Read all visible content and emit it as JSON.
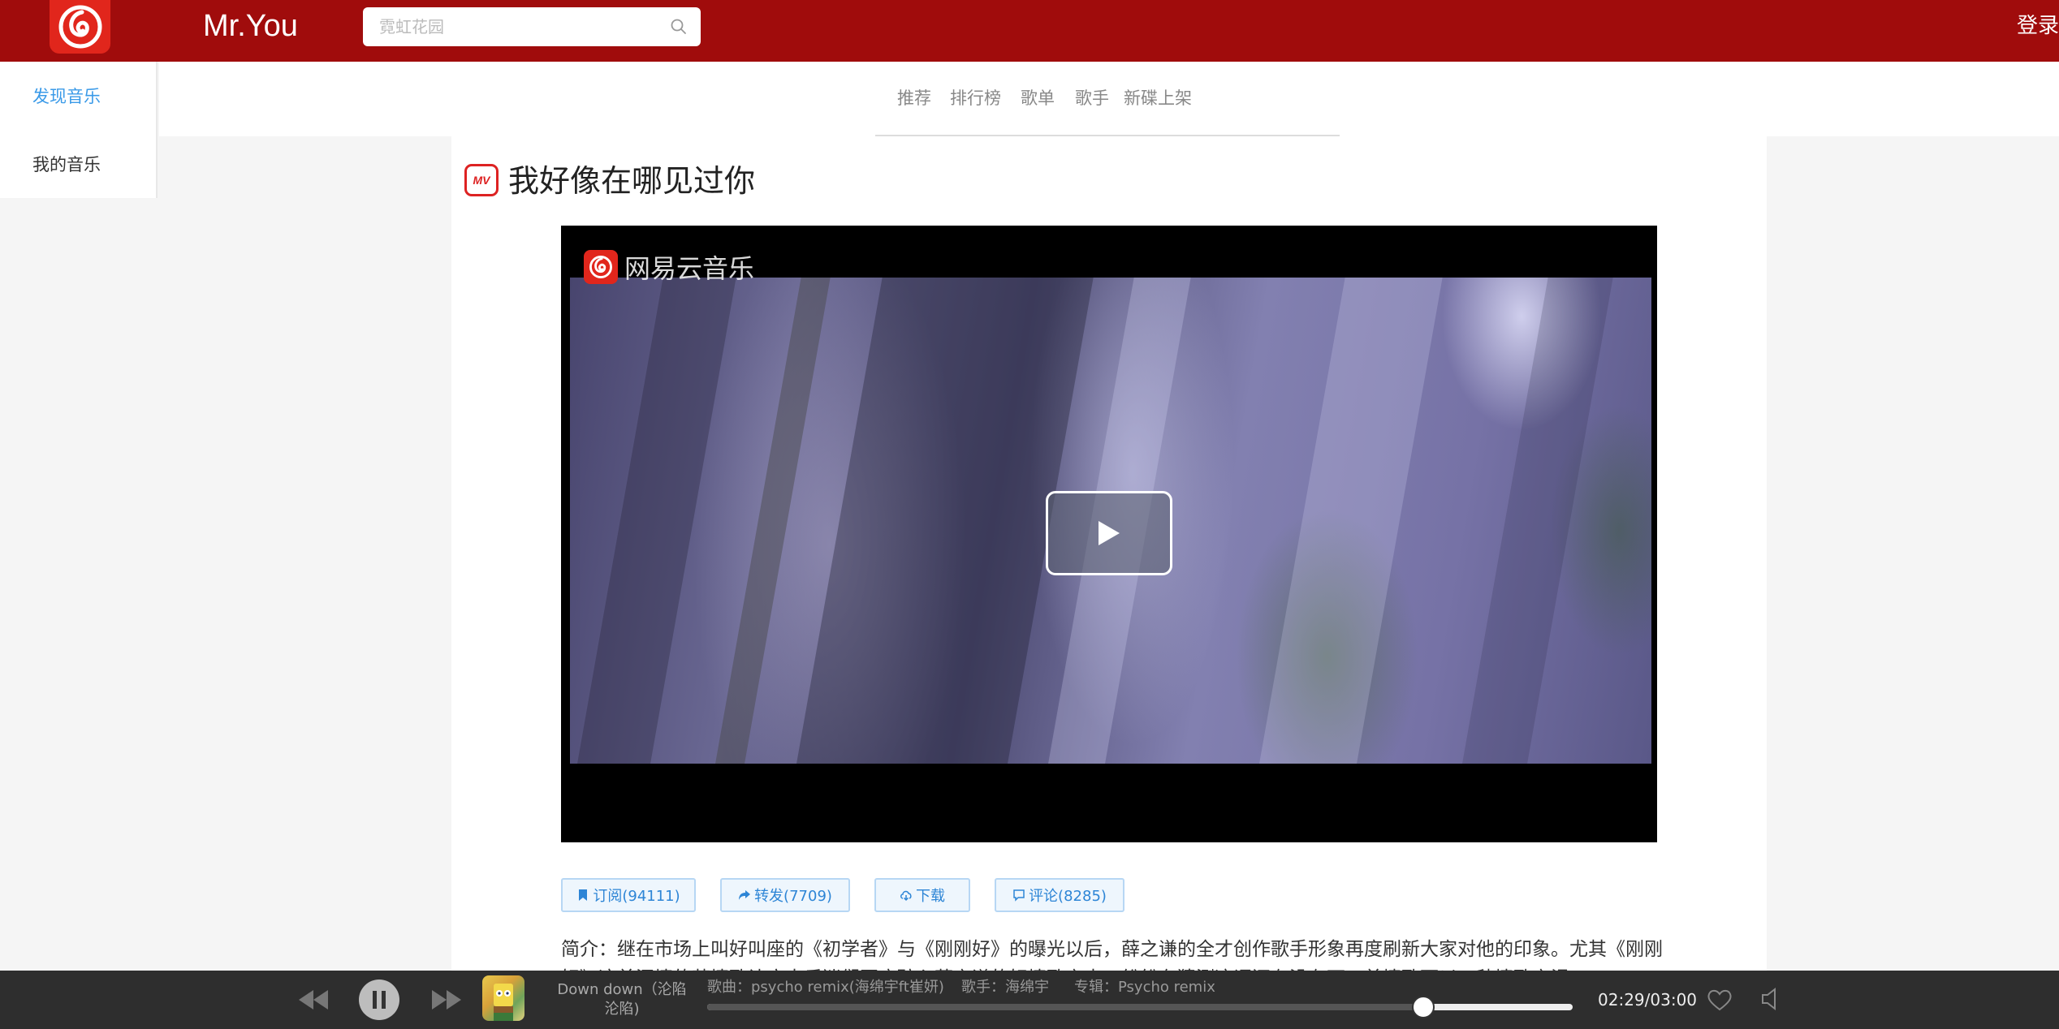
{
  "header": {
    "brand": "Mr.You",
    "search_placeholder": "霓虹花园",
    "login": "登录"
  },
  "sidebar": {
    "items": [
      {
        "label": "发现音乐",
        "active": true
      },
      {
        "label": "我的音乐",
        "active": false
      }
    ]
  },
  "subnav": {
    "items": [
      "推荐",
      "排行榜",
      "歌单",
      "歌手",
      "新碟上架"
    ]
  },
  "mv": {
    "badge": "MV",
    "title": "我好像在哪见过你",
    "watermark": "网易云音乐"
  },
  "actions": {
    "subscribe": "订阅(94111)",
    "share": "转发(7709)",
    "download": "下载",
    "comment": "评论(8285)"
  },
  "intro": "简介：继在市场上叫好叫座的《初学者》与《刚刚好》的曝光以后，薛之谦的全才创作歌手形象再度刷新大家对他的印象。尤其《刚刚好》这首深情的苦情歌让广大乐迷们再度醉心薛之谦的好情歌之中，纷纷在猜测这词还有没有下一首情歌可以一秒情歌之渴...",
  "player": {
    "now_small": "Down down（沦陷 沦陷)",
    "song": "歌曲：psycho remix(海绵宇ft崔妍)",
    "singer": "歌手：海绵宇",
    "album": "专辑：Psycho remix",
    "time": "02:29/03:00",
    "progress": 0.8278
  },
  "colors": {
    "header_bg": "#a00c0c",
    "accent": "#3a9ae8",
    "mv_red": "#d22"
  },
  "icons": [
    "netease-logo-icon",
    "search-icon",
    "mv-icon",
    "play-icon",
    "bookmark-icon",
    "share-icon",
    "cloud-download-icon",
    "comment-icon",
    "prev-icon",
    "pause-icon",
    "next-icon",
    "heart-icon",
    "volume-icon"
  ]
}
